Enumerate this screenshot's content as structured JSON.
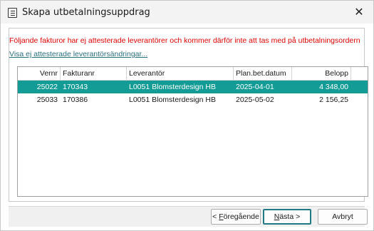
{
  "window": {
    "title": "Skapa utbetalningsuppdrag",
    "close_glyph": "✕"
  },
  "message": {
    "warning": "Följande fakturor har ej attesterade leverantörer och kommer därför inte att tas med på utbetalningsordern",
    "link": "Visa ej attesterade leverantörsändringar..."
  },
  "table": {
    "columns": [
      "Vernr",
      "Fakturanr",
      "Leverantör",
      "Plan.bet.datum",
      "Belopp"
    ],
    "rows": [
      {
        "vernr": "25022",
        "fakturanr": "170343",
        "leverantor": "L0051 Blomsterdesign HB",
        "datum": "2025-04-01",
        "belopp": "4 348,00",
        "selected": true
      },
      {
        "vernr": "25033",
        "fakturanr": "170386",
        "leverantor": "L0051 Blomsterdesign HB",
        "datum": "2025-05-02",
        "belopp": "2 156,25",
        "selected": false
      }
    ]
  },
  "buttons": {
    "prev_prefix": "< ",
    "prev_access": "F",
    "prev_rest": "öregående",
    "next_access": "N",
    "next_rest": "ästa >",
    "cancel": "Avbryt"
  },
  "colors": {
    "selection": "#139b96",
    "warning": "#e00000",
    "link": "#2a6f80"
  },
  "icons": {
    "title": "document-icon",
    "close": "close-icon"
  }
}
